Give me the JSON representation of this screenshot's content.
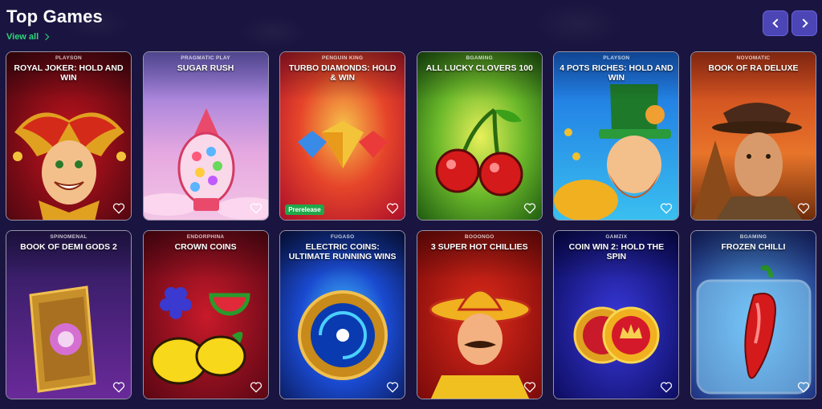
{
  "header": {
    "title": "Top Games",
    "view_all": "View all"
  },
  "icons": {
    "view_all": "chevron-right-icon",
    "prev": "chevron-left-icon",
    "next": "chevron-right-icon",
    "favorite": "heart-icon"
  },
  "colors": {
    "background": "#1a1540",
    "accent_green": "#2fd67a",
    "nav_button": "#4b45b5",
    "prerelease_badge": "#20a74a"
  },
  "games": [
    {
      "provider": "PLAYSON",
      "title": "ROYAL JOKER: HOLD AND WIN",
      "badge": ""
    },
    {
      "provider": "PRAGMATIC PLAY",
      "title": "SUGAR RUSH",
      "badge": ""
    },
    {
      "provider": "PENGUIN KING",
      "title": "TURBO DIAMONDS: HOLD & WIN",
      "badge": "Prerelease"
    },
    {
      "provider": "BGAMING",
      "title": "ALL LUCKY CLOVERS 100",
      "badge": ""
    },
    {
      "provider": "PLAYSON",
      "title": "4 POTS RICHES: HOLD AND WIN",
      "badge": ""
    },
    {
      "provider": "NOVOMATIC",
      "title": "BOOK OF RA DELUXE",
      "badge": ""
    },
    {
      "provider": "SPINOMENAL",
      "title": "BOOK OF DEMI GODS 2",
      "badge": ""
    },
    {
      "provider": "ENDORPHINA",
      "title": "CROWN COINS",
      "badge": ""
    },
    {
      "provider": "FUGASO",
      "title": "ELECTRIC COINS: ULTIMATE RUNNING WINS",
      "badge": ""
    },
    {
      "provider": "BOOONGO",
      "title": "3 SUPER HOT CHILLIES",
      "badge": ""
    },
    {
      "provider": "GAMZIX",
      "title": "COIN WIN 2: HOLD THE SPIN",
      "badge": ""
    },
    {
      "provider": "BGAMING",
      "title": "FROZEN CHILLI",
      "badge": ""
    }
  ]
}
